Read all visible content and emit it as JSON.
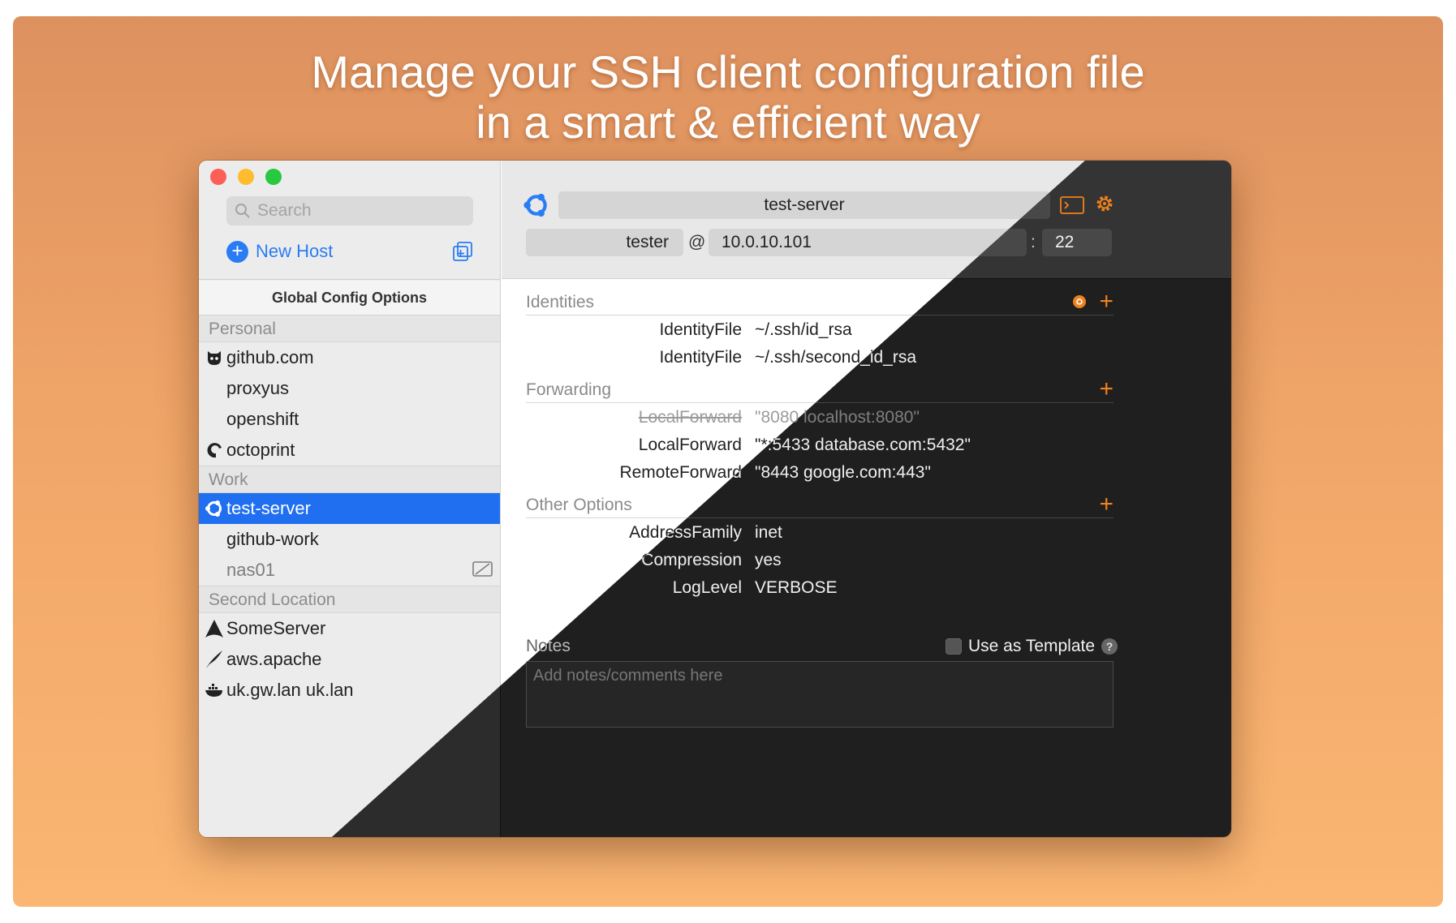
{
  "headline": {
    "line1": "Manage your SSH client configuration file",
    "line2": "in a smart & efficient way"
  },
  "sidebar": {
    "search_placeholder": "Search",
    "new_host_label": "New Host",
    "global_config_label": "Global Config Options",
    "groups": [
      {
        "label": "Personal"
      },
      {
        "label": "Work"
      },
      {
        "label": "Second Location"
      }
    ],
    "hosts": [
      {
        "label": "github.com",
        "icon": "github-icon"
      },
      {
        "label": "proxyus",
        "icon": ""
      },
      {
        "label": "openshift",
        "icon": ""
      },
      {
        "label": "octoprint",
        "icon": "octoprint-icon"
      },
      {
        "label": "test-server",
        "icon": "ubuntu-icon",
        "selected": true
      },
      {
        "label": "github-work",
        "icon": ""
      },
      {
        "label": "nas01",
        "icon": "",
        "disabled": true
      },
      {
        "label": "SomeServer",
        "icon": "arch-icon"
      },
      {
        "label": "aws.apache",
        "icon": "apache-feather-icon"
      },
      {
        "label": "uk.gw.lan uk.lan",
        "icon": "docker-icon"
      }
    ]
  },
  "detail": {
    "hostname": "test-server",
    "user": "tester",
    "at": "@",
    "host_ip": "10.0.10.101",
    "colon": ":",
    "port": "22",
    "sections": {
      "identities": {
        "title": "Identities",
        "items": [
          {
            "key": "IdentityFile",
            "value": "~/.ssh/id_rsa"
          },
          {
            "key": "IdentityFile",
            "value": "~/.ssh/second_id_rsa"
          }
        ]
      },
      "forwarding": {
        "title": "Forwarding",
        "items": [
          {
            "key": "LocalForward",
            "value": "\"8080 localhost:8080\"",
            "disabled": true
          },
          {
            "key": "LocalForward",
            "value": "\"*:5433 database.com:5432\""
          },
          {
            "key": "RemoteForward",
            "value": "\"8443 google.com:443\""
          }
        ]
      },
      "other": {
        "title": "Other Options",
        "items": [
          {
            "key": "AddressFamily",
            "value": "inet"
          },
          {
            "key": "Compression",
            "value": "yes"
          },
          {
            "key": "LogLevel",
            "value": "VERBOSE"
          }
        ]
      }
    },
    "notes_label": "Notes",
    "use_as_template_label": "Use as Template",
    "help_glyph": "?",
    "notes_placeholder": "Add notes/comments here"
  },
  "colors": {
    "accent_orange": "#f0821e",
    "selection_blue": "#1f6ff0",
    "link_blue": "#2a7cf4",
    "light_bg": "#ffffff",
    "dark_bg": "#1f1f1f"
  }
}
